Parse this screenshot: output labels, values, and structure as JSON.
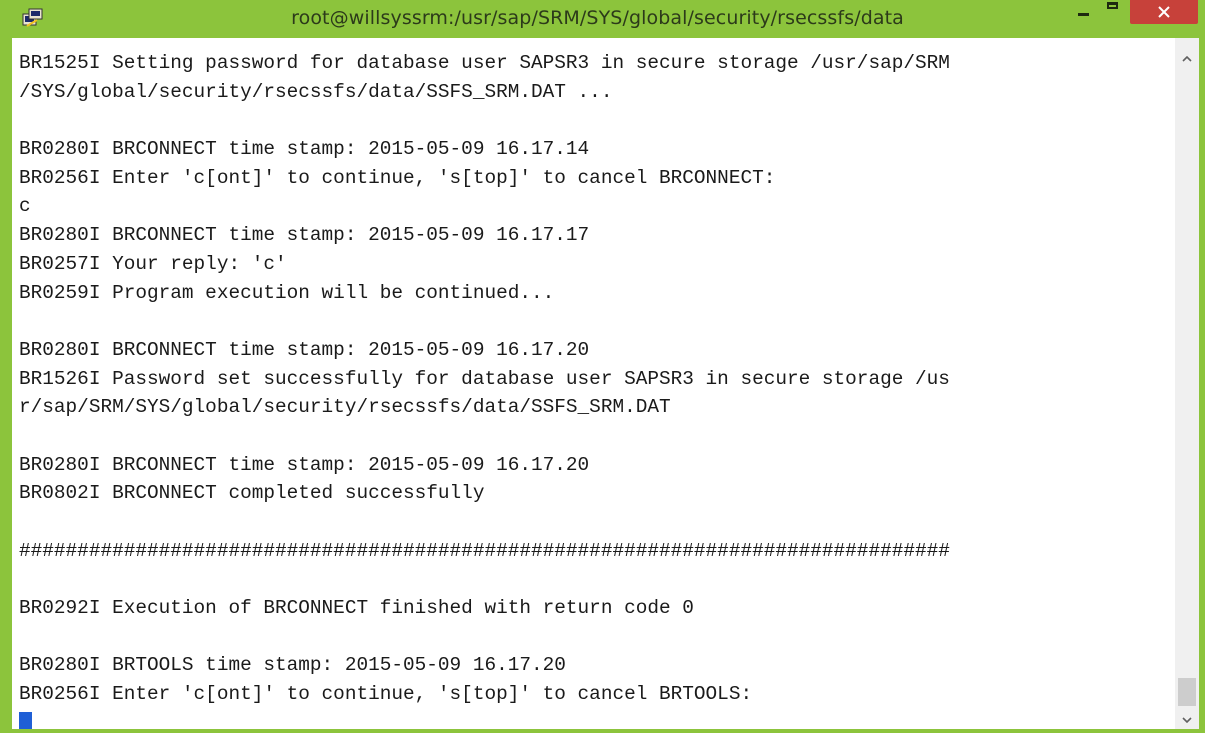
{
  "window": {
    "title": "root@willsyssrm:/usr/sap/SRM/SYS/global/security/rsecssfs/data",
    "icon": "putty-icon",
    "accent_color": "#8cc43c",
    "close_color": "#c7413a"
  },
  "terminal": {
    "lines": [
      "BR1525I Setting password for database user SAPSR3 in secure storage /usr/sap/SRM",
      "/SYS/global/security/rsecssfs/data/SSFS_SRM.DAT ...",
      "",
      "BR0280I BRCONNECT time stamp: 2015-05-09 16.17.14",
      "BR0256I Enter 'c[ont]' to continue, 's[top]' to cancel BRCONNECT:",
      "c",
      "BR0280I BRCONNECT time stamp: 2015-05-09 16.17.17",
      "BR0257I Your reply: 'c'",
      "BR0259I Program execution will be continued...",
      "",
      "BR0280I BRCONNECT time stamp: 2015-05-09 16.17.20",
      "BR1526I Password set successfully for database user SAPSR3 in secure storage /us",
      "r/sap/SRM/SYS/global/security/rsecssfs/data/SSFS_SRM.DAT",
      "",
      "BR0280I BRCONNECT time stamp: 2015-05-09 16.17.20",
      "BR0802I BRCONNECT completed successfully",
      "",
      "################################################################################",
      "",
      "BR0292I Execution of BRCONNECT finished with return code 0",
      "",
      "BR0280I BRTOOLS time stamp: 2015-05-09 16.17.20",
      "BR0256I Enter 'c[ont]' to continue, 's[top]' to cancel BRTOOLS:"
    ],
    "cursor_color": "#1f5fd6"
  }
}
